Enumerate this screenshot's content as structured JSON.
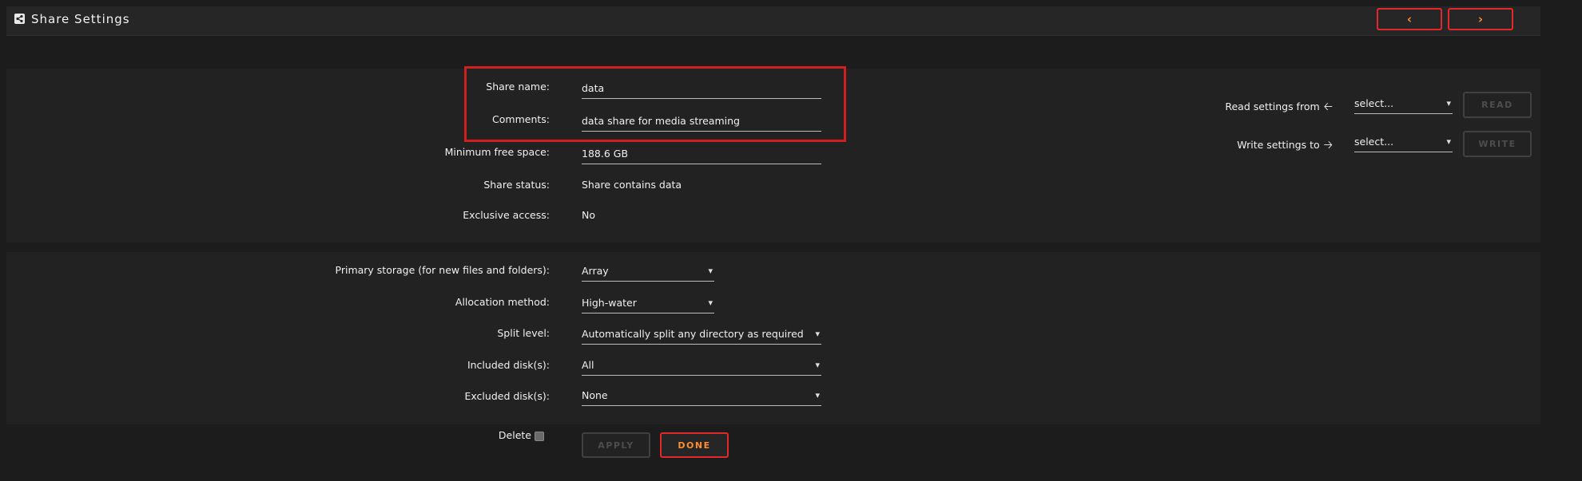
{
  "header": {
    "title": "Share Settings",
    "prev_icon": "chevron-left-icon",
    "next_icon": "chevron-right-icon",
    "accent": "#ff8c2f",
    "border": "#e22828"
  },
  "share": {
    "name_label": "Share name:",
    "name_value": "data",
    "comments_label": "Comments:",
    "comments_value": "data share for media streaming",
    "min_free_label": "Minimum free space:",
    "min_free_value": "188.6 GB",
    "status_label": "Share status:",
    "status_value": "Share contains data",
    "exclusive_label": "Exclusive access:",
    "exclusive_value": "No"
  },
  "settings_io": {
    "read_label": "Read settings from",
    "read_select": "select...",
    "read_button": "READ",
    "write_label": "Write settings to",
    "write_select": "select...",
    "write_button": "WRITE"
  },
  "storage": {
    "primary_label": "Primary storage (for new files and folders):",
    "primary_value": "Array",
    "allocation_label": "Allocation method:",
    "allocation_value": "High-water",
    "split_label": "Split level:",
    "split_value": "Automatically split any directory as required",
    "included_label": "Included disk(s):",
    "included_value": "All",
    "excluded_label": "Excluded disk(s):",
    "excluded_value": "None"
  },
  "actions": {
    "delete_label": "Delete",
    "apply_label": "APPLY",
    "done_label": "DONE"
  }
}
